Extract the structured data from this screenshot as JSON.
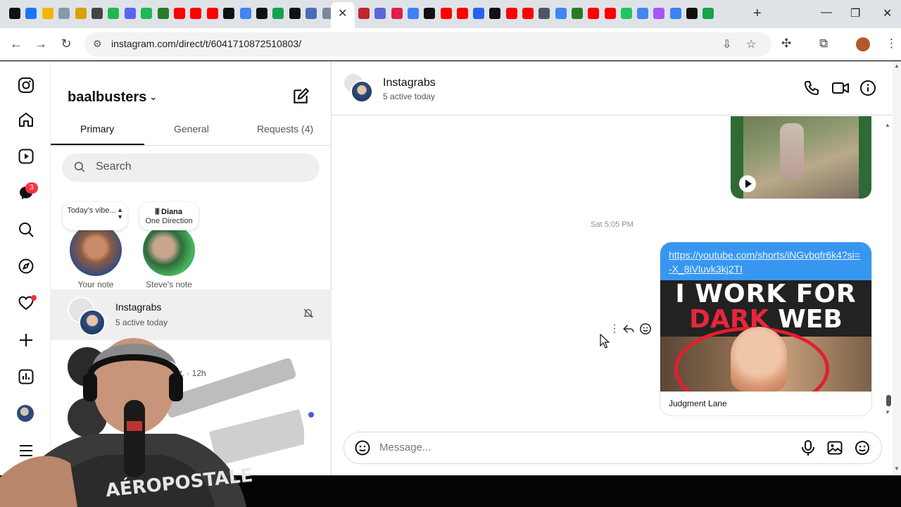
{
  "browser": {
    "new_tab_glyph": "+",
    "close_tab_glyph": "✕",
    "url": "instagram.com/direct/t/6041710872510803/",
    "window_controls": [
      "—",
      "❐",
      "✕"
    ],
    "tab_icon_colors": [
      "#111111",
      "#1877f2",
      "#f4b400",
      "#8899aa",
      "#d8a200",
      "#444444",
      "#1db954",
      "#5865f2",
      "#1db954",
      "#2a7a2a",
      "#ff0000",
      "#ff0000",
      "#ff0000",
      "#111111",
      "#4285f4",
      "#111111",
      "#16a34a",
      "#111111",
      "#4b6cb7",
      "#7a8a99",
      "#c1272d",
      "#5a67d8",
      "#e11d48",
      "#3b82f6",
      "#111111",
      "#ff0000",
      "#ff0000",
      "#2563eb",
      "#111111",
      "#ff0000",
      "#ff0000",
      "#4b5563",
      "#4285f4",
      "#2a7a2a",
      "#ff0000",
      "#ff0000",
      "#22c55e",
      "#4285f4",
      "#a855f7",
      "#3b82f6",
      "#111111",
      "#16a34a"
    ]
  },
  "rail": {
    "items": [
      "instagram-icon",
      "home-icon",
      "reels-icon",
      "messenger-icon",
      "search-icon",
      "explore-icon",
      "notifications-icon",
      "create-icon",
      "dashboard-icon",
      "profile-avatar",
      "menu-icon"
    ],
    "messages_badge": "3"
  },
  "inbox": {
    "account": "baalbusters",
    "tabs": [
      {
        "label": "Primary"
      },
      {
        "label": "General"
      },
      {
        "label": "Requests (4)"
      }
    ],
    "search_placeholder": "Search",
    "notes": [
      {
        "bubble": "Today's vibe...",
        "label": "Your note"
      },
      {
        "bubble_title": "Diana",
        "bubble_sub": "One Direction",
        "label": "Steve's note"
      }
    ],
    "threads": [
      {
        "name": "Instagrabs",
        "sub": "5 active today"
      },
      {
        "name": "",
        "sub": "ment. · 12h"
      },
      {
        "name": "",
        "sub": ""
      }
    ]
  },
  "chat": {
    "name": "Instagrabs",
    "sub": "5 active today",
    "timestamp": "Sat 5:05 PM",
    "shared_link": "https://youtube.com/shorts/iNGvbqfr6k4?si=-X_8iVluvk3kj2TI",
    "thumb_line1": "I WORK FOR",
    "thumb_line2_red": "DARK",
    "thumb_line2_white": "WEB",
    "caption": "Judgment Lane",
    "composer_placeholder": "Message..."
  }
}
